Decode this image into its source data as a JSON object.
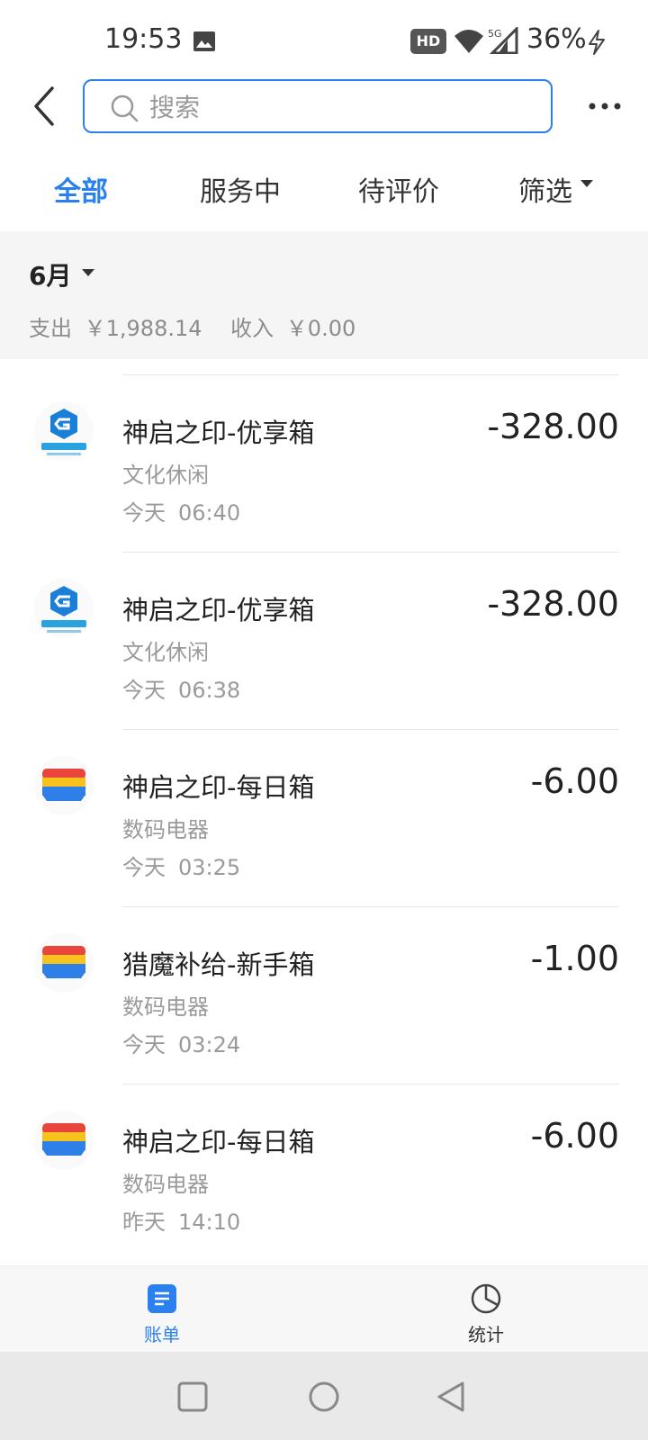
{
  "status_bar": {
    "time": "19:53",
    "hd_badge": "HD",
    "network": "5G",
    "battery": "36%"
  },
  "header": {
    "search_placeholder": "搜索"
  },
  "tabs": [
    {
      "label": "全部",
      "active": true
    },
    {
      "label": "服务中",
      "active": false
    },
    {
      "label": "待评价",
      "active": false
    },
    {
      "label": "筛选",
      "active": false
    }
  ],
  "summary": {
    "month": "6月",
    "expense_label": "支出",
    "expense_value": "￥1,988.14",
    "income_label": "收入",
    "income_value": "￥0.00"
  },
  "transactions": [
    {
      "title": "神启之印-优享箱",
      "category": "文化休闲",
      "day": "今天",
      "time": "06:40",
      "amount": "-328.00",
      "logo": "game-logo-icon"
    },
    {
      "title": "神启之印-优享箱",
      "category": "文化休闲",
      "day": "今天",
      "time": "06:38",
      "amount": "-328.00",
      "logo": "game-logo-icon"
    },
    {
      "title": "神启之印-每日箱",
      "category": "数码电器",
      "day": "今天",
      "time": "03:25",
      "amount": "-6.00",
      "logo": "wallet-logo-icon"
    },
    {
      "title": "猎魔补给-新手箱",
      "category": "数码电器",
      "day": "今天",
      "time": "03:24",
      "amount": "-1.00",
      "logo": "wallet-logo-icon"
    },
    {
      "title": "神启之印-每日箱",
      "category": "数码电器",
      "day": "昨天",
      "time": "14:10",
      "amount": "-6.00",
      "logo": "wallet-logo-icon"
    }
  ],
  "bottom_nav": [
    {
      "label": "账单",
      "icon": "bill-icon",
      "active": true
    },
    {
      "label": "统计",
      "icon": "pie-chart-icon",
      "active": false
    }
  ],
  "colors": {
    "accent": "#2a80ee",
    "summary_bg": "#f5f5f5"
  }
}
